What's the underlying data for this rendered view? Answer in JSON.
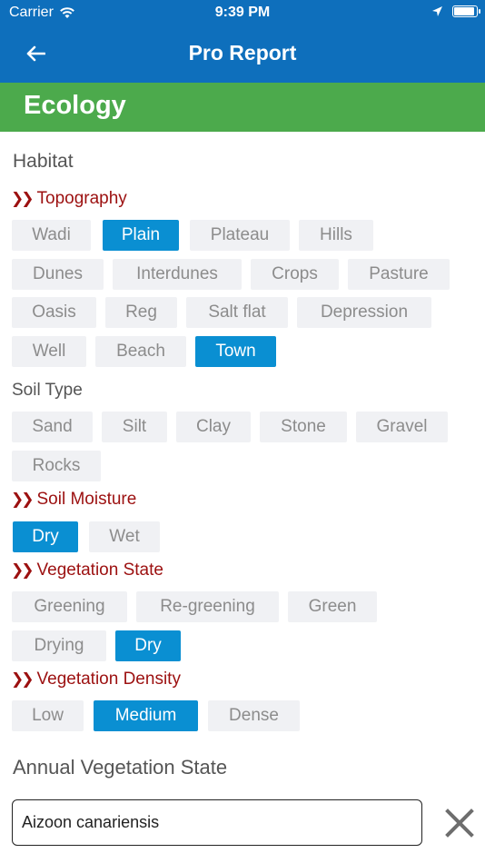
{
  "status": {
    "carrier": "Carrier",
    "time": "9:39 PM"
  },
  "nav": {
    "title": "Pro Report",
    "back_icon": "arrow-left-icon"
  },
  "section": {
    "title": "Ecology"
  },
  "habitat": {
    "title": "Habitat"
  },
  "topography": {
    "title": "Topography",
    "options": [
      "Wadi",
      "Plain",
      "Plateau",
      "Hills",
      "Dunes",
      "Interdunes",
      "Crops",
      "Pasture",
      "Oasis",
      "Reg",
      "Salt flat",
      "Depression",
      "Well",
      "Beach",
      "Town"
    ],
    "selected": [
      "Plain",
      "Town"
    ]
  },
  "soil_type": {
    "title": "Soil Type",
    "options": [
      "Sand",
      "Silt",
      "Clay",
      "Stone",
      "Gravel",
      "Rocks"
    ],
    "selected": []
  },
  "soil_moisture": {
    "title": "Soil Moisture",
    "options": [
      "Dry",
      "Wet"
    ],
    "selected": [
      "Dry"
    ]
  },
  "vegetation_state": {
    "title": "Vegetation State",
    "options": [
      "Greening",
      "Re-greening",
      "Green",
      "Drying",
      "Dry"
    ],
    "selected": [
      "Dry"
    ]
  },
  "vegetation_density": {
    "title": "Vegetation Density",
    "options": [
      "Low",
      "Medium",
      "Dense"
    ],
    "selected": [
      "Medium"
    ]
  },
  "annual": {
    "title": "Annual Vegetation State",
    "species_value": "Aizoon canariensis",
    "clear_icon": "close-icon"
  }
}
